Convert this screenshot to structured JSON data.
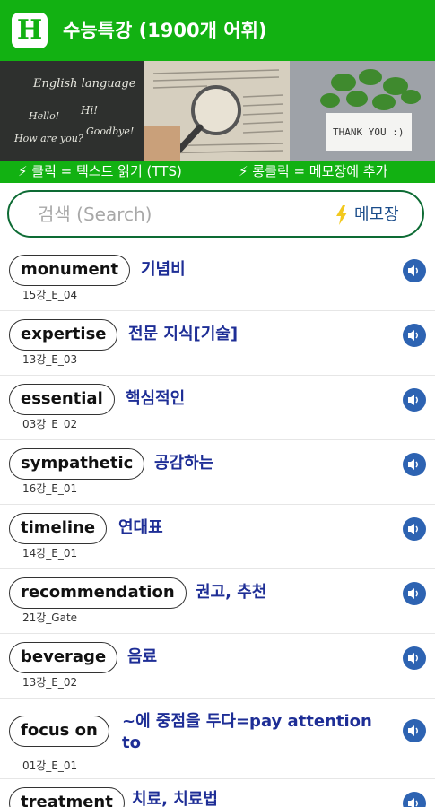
{
  "app": {
    "logo_letter": "H",
    "title": "수능특강 (1900개 어휘)"
  },
  "banner": {
    "panel1_lines": [
      "English language",
      "Hello!",
      "Hi!",
      "How are you?",
      "Goodbye!"
    ],
    "panel3_card": "THANK YOU :)"
  },
  "hints": {
    "left": "⚡ 클릭 = 텍스트 읽기 (TTS)",
    "right": "⚡ 롱클릭 = 메모장에 추가"
  },
  "search": {
    "placeholder": "검색 (Search)",
    "memo_label": "메모장"
  },
  "words": [
    {
      "word": "monument",
      "meaning": "기념비",
      "source": "15강_E_04"
    },
    {
      "word": "expertise",
      "meaning": "전문 지식[기술]",
      "source": "13강_E_03"
    },
    {
      "word": "essential",
      "meaning": "핵심적인",
      "source": "03강_E_02"
    },
    {
      "word": "sympathetic",
      "meaning": "공감하는",
      "source": "16강_E_01"
    },
    {
      "word": "timeline",
      "meaning": "연대표",
      "source": "14강_E_01"
    },
    {
      "word": "recommendation",
      "meaning": "권고, 추천",
      "source": "21강_Gate"
    },
    {
      "word": "beverage",
      "meaning": "음료",
      "source": "13강_E_02"
    },
    {
      "word": "focus on",
      "meaning": "~에 중점을 두다=pay attention to",
      "source": "01강_E_01"
    },
    {
      "word": "treatment",
      "meaning": "치료, 치료법",
      "source": ""
    }
  ],
  "colors": {
    "brand_green": "#12b112",
    "meaning_text": "#1e2e96",
    "speaker": "#2d63b2",
    "search_border": "#0d6b34"
  }
}
